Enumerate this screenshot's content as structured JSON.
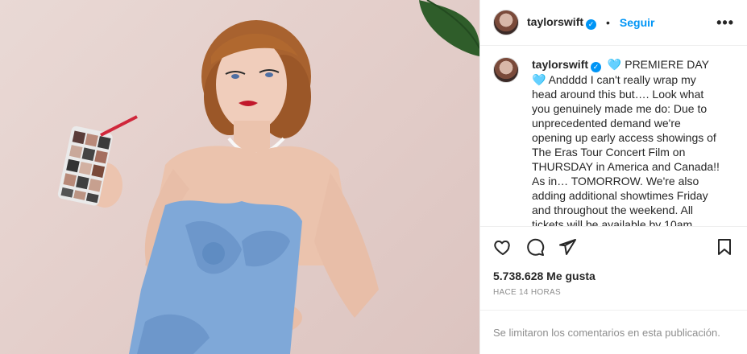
{
  "post": {
    "username": "taylorswift",
    "separator": "•",
    "follow_label": "Seguir",
    "more_label": "•••",
    "caption_lead": "🩵 PREMIERE DAY 🩵",
    "caption_body": "Andddd I can't really wrap my head around this but…. Look what you genuinely made me do: Due to unprecedented demand we're opening up early access showings of The Eras Tour Concert Film on THURSDAY in America and Canada!! As in… TOMORROW. We're also adding additional showtimes Friday and throughout the weekend. All tickets will be available by 10am",
    "likes": "5.738.628 Me gusta",
    "timestamp": "HACE 14 HORAS",
    "comments_disabled": "Se limitaron los comentarios en esta publicación."
  },
  "colors": {
    "accent": "#0095f6",
    "dress": "#7fa8d8",
    "wall": "#e6d4d0"
  },
  "icons": {
    "verified": "verified-badge-icon",
    "like": "heart-icon",
    "comment": "comment-icon",
    "share": "paper-plane-icon",
    "save": "bookmark-icon"
  }
}
